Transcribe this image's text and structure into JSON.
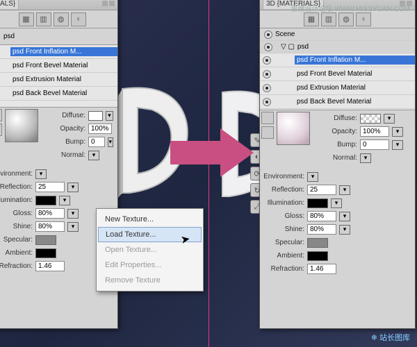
{
  "watermarks": {
    "top": "思缘设计论坛  WWW.MISSYUAN.COM",
    "bottom": "❄ 站长图库"
  },
  "panel_title": "3D {MATERIALS}",
  "left_panel_tab": "RIALS}",
  "scene_label": "Scene",
  "psd_label": "psd",
  "layers": [
    {
      "label": "psd Front Inflation M...",
      "selected": true
    },
    {
      "label": "psd Front Bevel Material",
      "selected": false
    },
    {
      "label": "psd Extrusion Material",
      "selected": false
    },
    {
      "label": "psd Back Bevel Material",
      "selected": false
    }
  ],
  "props": {
    "diffuse": "Diffuse:",
    "opacity": "Opacity:",
    "opacity_val": "100%",
    "bump": "Bump:",
    "bump_val": "0",
    "normal": "Normal:",
    "environment": "Environment:",
    "reflection": "Reflection:",
    "reflection_val": "25",
    "illumination": "Illumination:",
    "gloss": "Gloss:",
    "gloss_val": "80%",
    "shine": "Shine:",
    "shine_val": "80%",
    "specular": "Specular:",
    "ambient": "Ambient:",
    "refraction": "Refraction:",
    "refraction_val": "1.46"
  },
  "context_menu": {
    "new": "New Texture...",
    "load": "Load Texture...",
    "open": "Open Texture...",
    "edit": "Edit Properties...",
    "remove": "Remove Texture"
  }
}
